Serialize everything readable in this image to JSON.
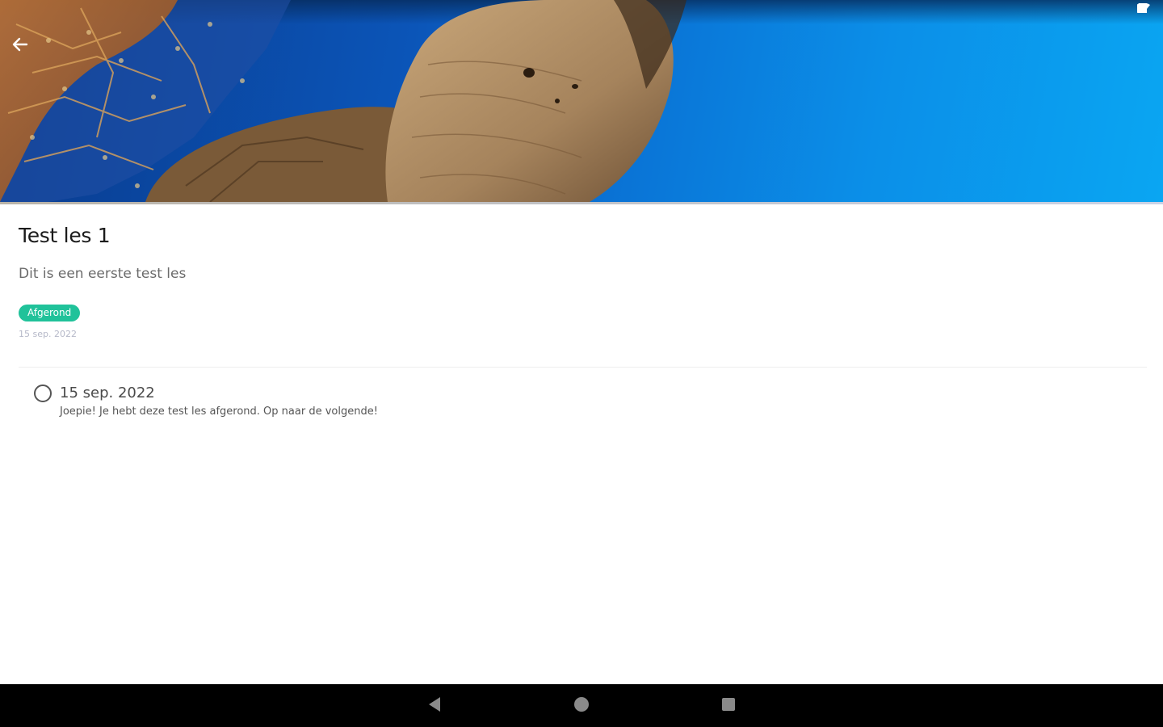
{
  "lesson": {
    "title": "Test les 1",
    "description": "Dit is een eerste test les",
    "status": "Afgerond",
    "date": "15 sep. 2022"
  },
  "timeline": {
    "items": [
      {
        "date": "15 sep. 2022",
        "message": "Joepie! Je hebt deze test les afgerond. Op naar de volgende!"
      }
    ]
  },
  "colors": {
    "status_badge": "#20c29a",
    "hero_water": "#0aa6f2"
  },
  "icons": {
    "back": "arrow-left-icon",
    "status_bar": [
      "vibrate-icon",
      "wifi-icon",
      "signal-icon",
      "battery-icon"
    ],
    "nav": [
      "back-triangle-icon",
      "home-circle-icon",
      "recents-square-icon"
    ]
  }
}
